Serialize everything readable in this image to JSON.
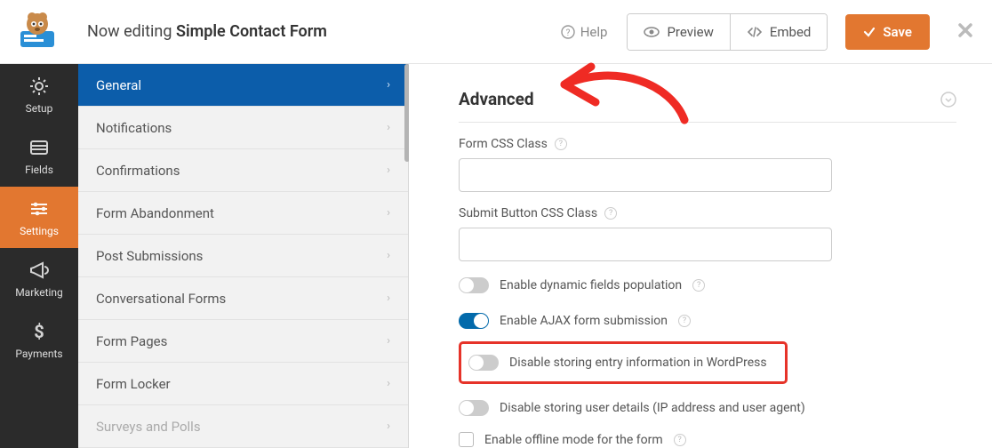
{
  "header": {
    "prefix": "Now editing ",
    "form_name": "Simple Contact Form",
    "help": "Help",
    "preview": "Preview",
    "embed": "Embed",
    "save": "Save"
  },
  "rail": {
    "items": [
      {
        "label": "Setup"
      },
      {
        "label": "Fields"
      },
      {
        "label": "Settings"
      },
      {
        "label": "Marketing"
      },
      {
        "label": "Payments"
      }
    ],
    "active_index": 2
  },
  "settings_menu": {
    "items": [
      {
        "label": "General"
      },
      {
        "label": "Notifications"
      },
      {
        "label": "Confirmations"
      },
      {
        "label": "Form Abandonment"
      },
      {
        "label": "Post Submissions"
      },
      {
        "label": "Conversational Forms"
      },
      {
        "label": "Form Pages"
      },
      {
        "label": "Form Locker"
      },
      {
        "label": "Surveys and Polls"
      }
    ],
    "active_index": 0
  },
  "advanced": {
    "title": "Advanced",
    "form_css_label": "Form CSS Class",
    "form_css_value": "",
    "submit_css_label": "Submit Button CSS Class",
    "submit_css_value": "",
    "toggles": {
      "dynamic_fields": {
        "label": "Enable dynamic fields population",
        "on": false
      },
      "ajax": {
        "label": "Enable AJAX form submission",
        "on": true
      },
      "disable_entry": {
        "label": "Disable storing entry information in WordPress",
        "on": false
      },
      "disable_user": {
        "label": "Disable storing user details (IP address and user agent)",
        "on": false
      }
    },
    "offline_label": "Enable offline mode for the form"
  }
}
